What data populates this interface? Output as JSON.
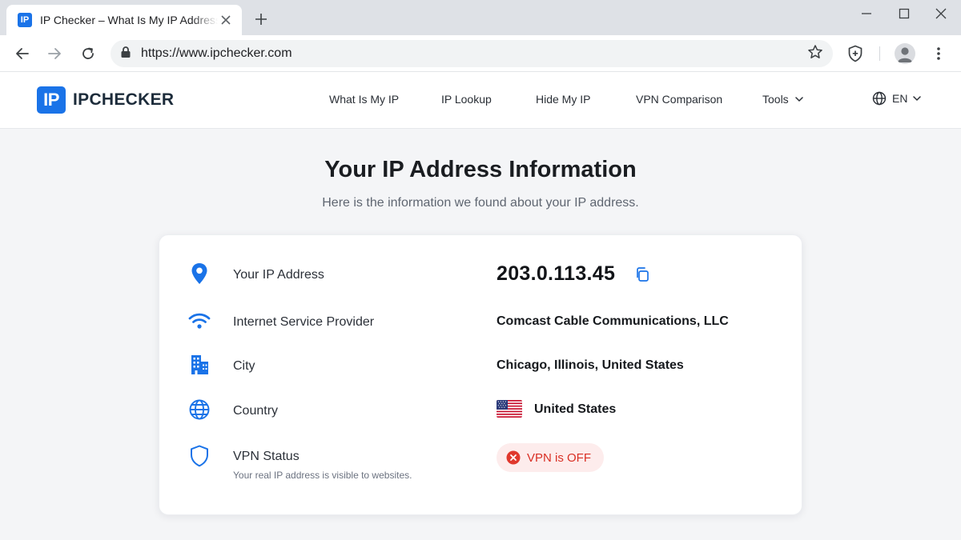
{
  "browser": {
    "tab_title": "IP Checker – What Is My IP Address",
    "favicon_text": "IP",
    "url": "https://www.ipchecker.com",
    "icons": [
      "back-arrow-icon",
      "forward-arrow-icon",
      "reload-icon",
      "lock-icon",
      "star-icon",
      "shield-extension-icon",
      "profile-icon",
      "kebab-menu-icon",
      "close-icon",
      "plus-icon",
      "minimize-icon",
      "maximize-icon"
    ]
  },
  "site": {
    "logo_badge": "IP",
    "logo_text": "IPCHECKER",
    "brand_color": "#1a73e8",
    "nav": {
      "what_is_my_ip": "What Is My IP",
      "ip_lookup": "IP Lookup",
      "hide_my_ip": "Hide My IP",
      "vpn_comparison": "VPN Comparison",
      "tools": "Tools"
    },
    "language": "EN"
  },
  "main": {
    "title": "Your IP Address Information",
    "subtitle": "Here is the information we found about your IP address."
  },
  "info": {
    "ip": {
      "label": "Your IP Address",
      "value": "203.0.113.45",
      "icon": "location-pin-icon"
    },
    "isp": {
      "label": "Internet Service Provider",
      "value": "Comcast Cable Communications, LLC",
      "icon": "wifi-icon"
    },
    "city": {
      "label": "City",
      "value": "Chicago, Illinois, United States",
      "icon": "building-icon"
    },
    "country": {
      "label": "Country",
      "value": "United States",
      "icon": "globe-icon",
      "flag": "us-flag"
    },
    "vpn": {
      "label": "VPN Status",
      "sublabel": "Your real IP address is visible to websites.",
      "status": "VPN is OFF",
      "icon": "shield-icon",
      "status_color": "#d93025",
      "status_bg": "#fdecec"
    }
  }
}
